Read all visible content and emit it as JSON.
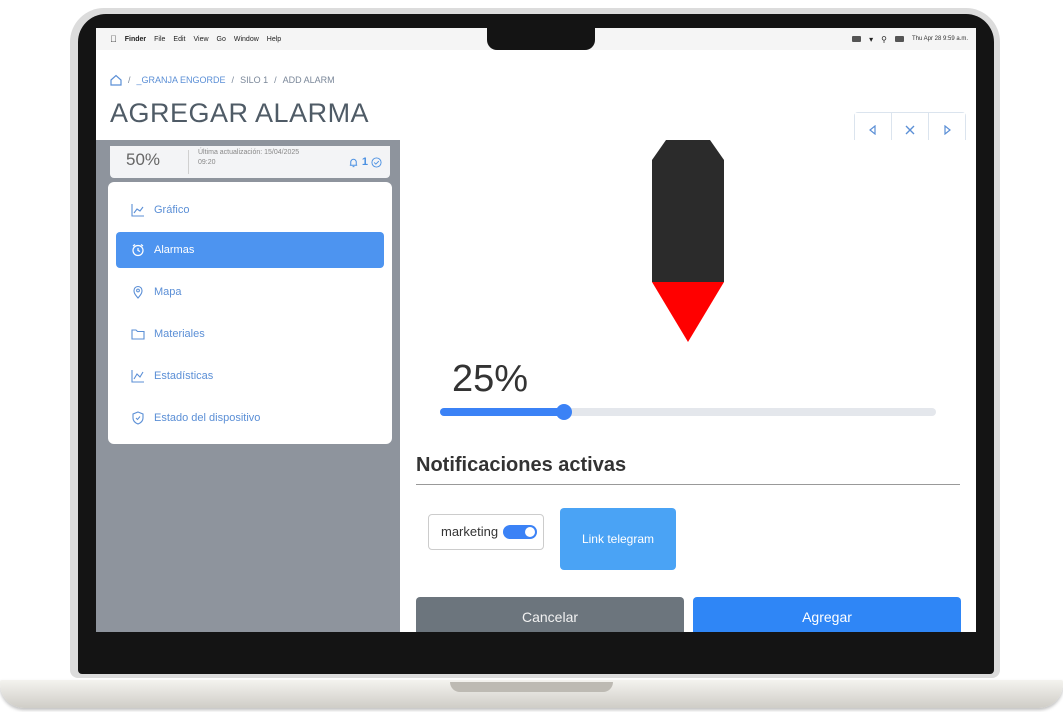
{
  "menubar": {
    "items": [
      "Finder",
      "File",
      "Edit",
      "View",
      "Go",
      "Window",
      "Help"
    ],
    "clock": "Thu Apr 28 9:59 a.m."
  },
  "breadcrumb": {
    "sep": "/",
    "items": [
      "_GRANJA ENGORDE",
      "SILO 1",
      "ADD ALARM"
    ]
  },
  "page": {
    "title": "AGREGAR ALARMA"
  },
  "status": {
    "percent": "50%",
    "updated": "Última actualización: 15/04/2025 09:20",
    "alerts_count": "1"
  },
  "sidebar": {
    "items": [
      {
        "label": "Gráfico",
        "icon": "chart-line-icon",
        "active": false
      },
      {
        "label": "Alarmas",
        "icon": "alarm-clock-icon",
        "active": true
      },
      {
        "label": "Mapa",
        "icon": "map-pin-icon",
        "active": false
      },
      {
        "label": "Materiales",
        "icon": "folder-icon",
        "active": false
      },
      {
        "label": "Estadísticas",
        "icon": "chart-area-icon",
        "active": false
      },
      {
        "label": "Estado del dispositivo",
        "icon": "shield-icon",
        "active": false
      }
    ]
  },
  "alarm": {
    "level_label": "25%",
    "level_fraction": 0.25,
    "level_color": "#ff0000",
    "silo_color": "#2b2b2b"
  },
  "notifications": {
    "title": "Notificaciones activas",
    "channel_label": "marketing",
    "channel_enabled": true,
    "telegram_button": "Link telegram"
  },
  "actions": {
    "cancel": "Cancelar",
    "add": "Agregar"
  },
  "colors": {
    "accent": "#3b82f6",
    "sidebar_bg": "#8e949d",
    "cancel_bg": "#6c757d"
  }
}
